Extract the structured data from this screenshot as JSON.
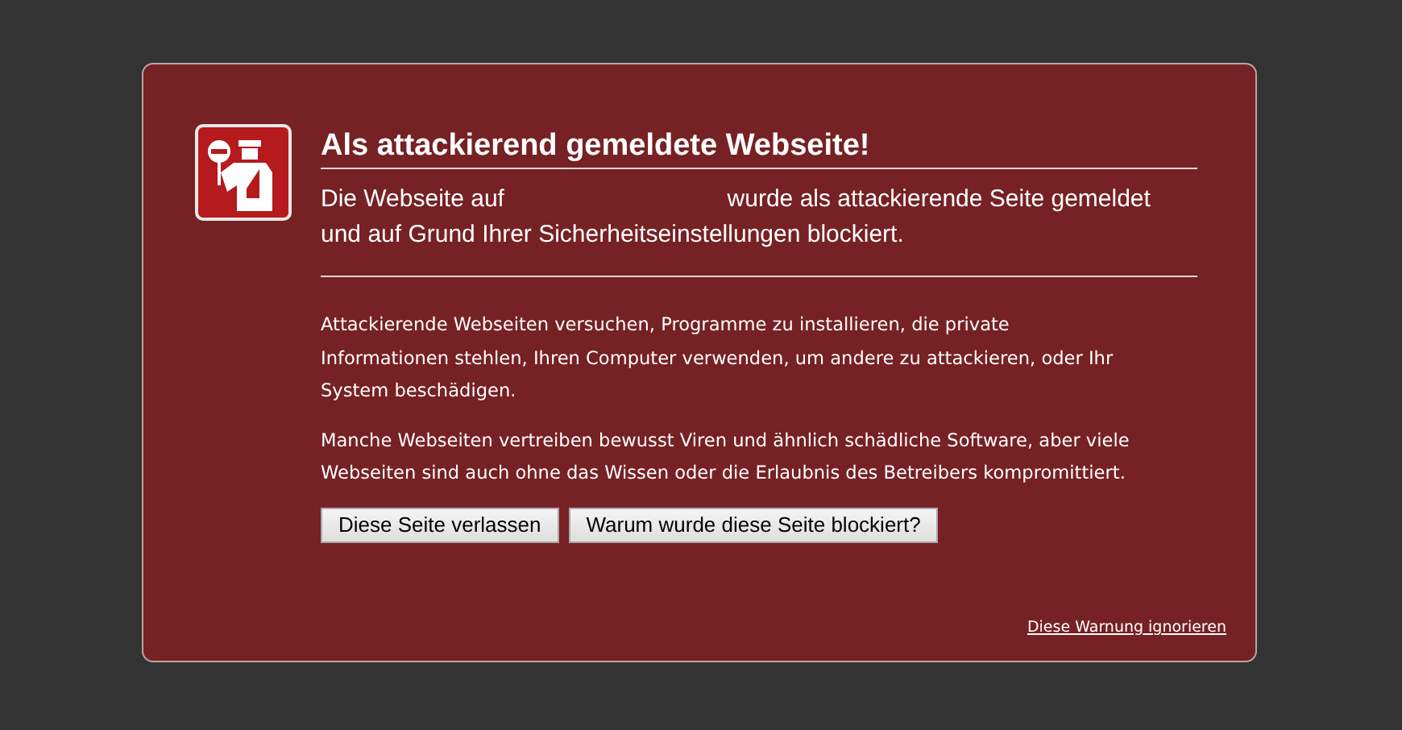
{
  "title": "Als attackierend gemeldete Webseite!",
  "intro": {
    "before": "Die Webseite auf",
    "after": "wurde als attackierende Seite gemeldet und auf Grund Ihrer Sicherheitseinstellungen blockiert."
  },
  "paragraphs": [
    "Attackierende Webseiten versuchen, Programme zu installieren, die private Informationen stehlen, Ihren Computer verwenden, um andere zu attackieren, oder Ihr System beschädigen.",
    "Manche Webseiten vertreiben bewusst Viren und ähnlich schädliche Software, aber viele Webseiten sind auch ohne das Wissen oder die Erlaubnis des Betreibers kompromittiert."
  ],
  "buttons": [
    "Diese Seite verlassen",
    "Warum wurde diese Seite blockiert?"
  ],
  "ignore_link": "Diese Warnung ignorieren"
}
